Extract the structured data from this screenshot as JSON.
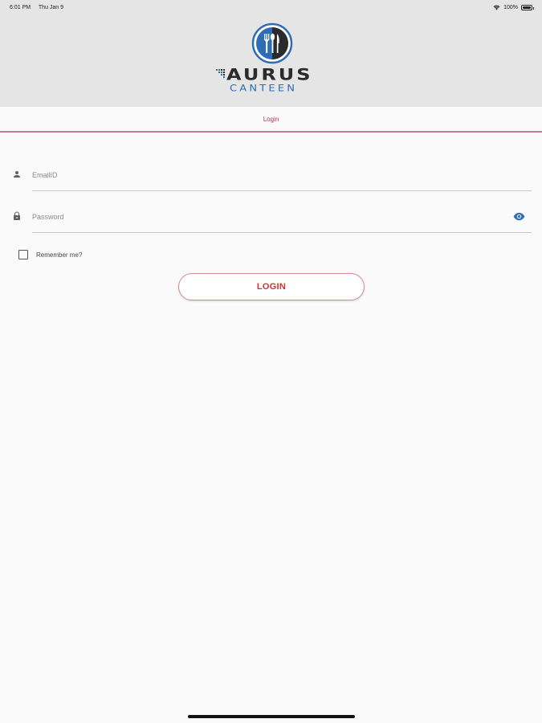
{
  "status_bar": {
    "time": "6:01 PM",
    "date": "Thu Jan 9",
    "battery": "100%"
  },
  "header": {
    "logo_main": "AURUS",
    "logo_sub": "CANTEEN"
  },
  "tab": {
    "label": "Login"
  },
  "form": {
    "email_placeholder": "EmailID",
    "email_value": "",
    "password_placeholder": "Password",
    "password_value": "",
    "remember_label": "Remember me?",
    "remember_checked": false,
    "login_label": "LOGIN"
  },
  "colors": {
    "accent": "#a6385a",
    "login_text": "#d0342c",
    "eye_icon": "#2e6db5",
    "logo_blue": "#2e6db5"
  },
  "icons": [
    "user-icon",
    "lock-icon",
    "eye-icon",
    "wifi-icon",
    "battery-icon"
  ]
}
